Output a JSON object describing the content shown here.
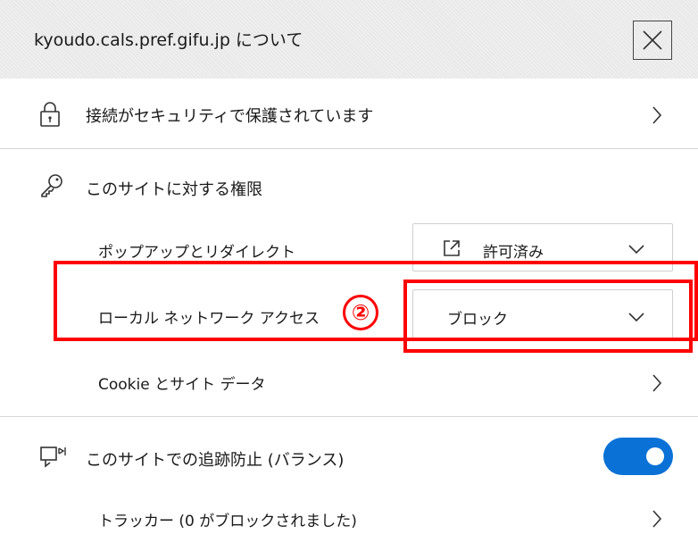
{
  "header": {
    "title": "kyoudo.cals.pref.gifu.jp について",
    "close_icon": "close-icon"
  },
  "connection": {
    "label": "接続がセキュリティで保護されています",
    "icon": "lock-icon"
  },
  "permissions": {
    "heading": "このサイトに対する権限",
    "icon": "key-icon",
    "popup": {
      "label": "ポップアップとリダイレクト",
      "value": "許可済み",
      "icon": "open-external-icon"
    },
    "local_network": {
      "label": "ローカル ネットワーク アクセス",
      "value": "ブロック"
    },
    "cookie": {
      "label": "Cookie とサイト データ"
    }
  },
  "tracking": {
    "label": "このサイトでの追跡防止 (バランス)",
    "icon": "tracking-prevention-icon",
    "toggle_on": true,
    "toggle_color": "#0a72d6",
    "trackers_label": "トラッカー (0 がブロックされました)"
  },
  "annotation": {
    "marker": "②",
    "highlight_color": "#ff0000"
  }
}
